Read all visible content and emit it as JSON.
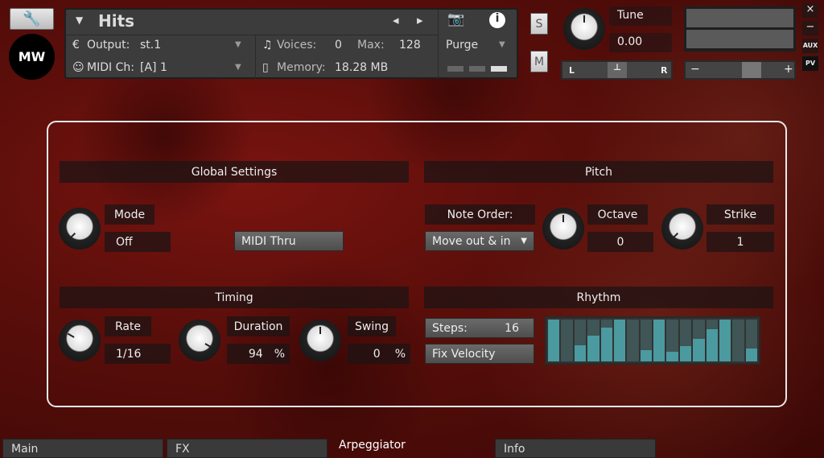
{
  "header": {
    "instrument_name": "Hits",
    "output_label": "Output:",
    "output_value": "st.1",
    "midi_label": "MIDI Ch:",
    "midi_value": "[A]  1",
    "voices_label": "Voices:",
    "voices_value": "0",
    "max_label": "Max:",
    "max_value": "128",
    "memory_label": "Memory:",
    "memory_value": "18.28 MB",
    "purge_label": "Purge"
  },
  "controls": {
    "solo": "S",
    "mute": "M",
    "tune_label": "Tune",
    "tune_value": "0.00",
    "pan_left": "L",
    "pan_right": "R",
    "vol_minus": "−",
    "vol_plus": "+",
    "close": "×",
    "minimize": "−",
    "aux": "AUX",
    "pv": "PV"
  },
  "global": {
    "title": "Global Settings",
    "mode_label": "Mode",
    "mode_value": "Off",
    "midi_thru": "MIDI Thru"
  },
  "pitch": {
    "title": "Pitch",
    "note_order_label": "Note Order:",
    "note_order_value": "Move out & in",
    "octave_label": "Octave",
    "octave_value": "0",
    "strike_label": "Strike",
    "strike_value": "1"
  },
  "timing": {
    "title": "Timing",
    "rate_label": "Rate",
    "rate_value": "1/16",
    "duration_label": "Duration",
    "duration_value": "94",
    "duration_unit": "%",
    "swing_label": "Swing",
    "swing_value": "0",
    "swing_unit": "%"
  },
  "rhythm": {
    "title": "Rhythm",
    "steps_label": "Steps:",
    "steps_value": "16",
    "fix_velocity": "Fix Velocity",
    "step_levels": [
      1.0,
      0,
      0.38,
      0.62,
      0.8,
      1.0,
      0,
      0.27,
      1.0,
      0.24,
      0.36,
      0.54,
      0.77,
      1.0,
      0,
      0.3
    ]
  },
  "tabs": [
    {
      "label": "Main"
    },
    {
      "label": "FX"
    },
    {
      "label": "Arpeggiator"
    },
    {
      "label": "Info"
    }
  ],
  "active_tab": "Arpeggiator"
}
